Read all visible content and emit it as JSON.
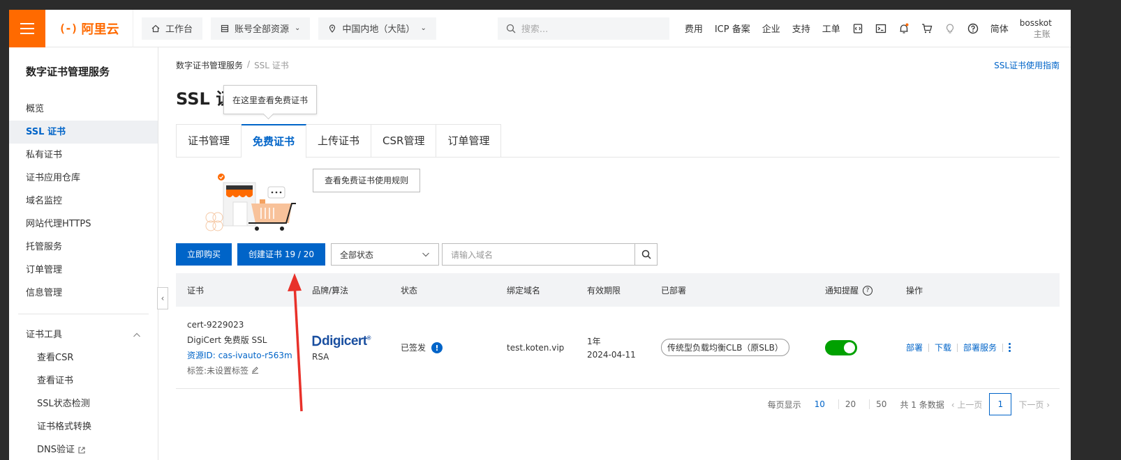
{
  "topbar": {
    "logo_text": "阿里云",
    "workbench": "工作台",
    "resources": "账号全部资源",
    "region": "中国内地（大陆）",
    "search_placeholder": "搜索...",
    "links": [
      "费用",
      "ICP 备案",
      "企业",
      "支持",
      "工单"
    ],
    "lang": "简体",
    "user": "bosskot",
    "user_sub": "主账"
  },
  "sidebar": {
    "title": "数字证书管理服务",
    "items": [
      {
        "label": "概览"
      },
      {
        "label": "SSL 证书",
        "active": true
      },
      {
        "label": "私有证书"
      },
      {
        "label": "证书应用仓库"
      },
      {
        "label": "域名监控"
      },
      {
        "label": "网站代理HTTPS"
      },
      {
        "label": "托管服务"
      },
      {
        "label": "订单管理"
      },
      {
        "label": "信息管理"
      }
    ],
    "group_title": "证书工具",
    "group_items": [
      {
        "label": "查看CSR"
      },
      {
        "label": "查看证书"
      },
      {
        "label": "SSL状态检测"
      },
      {
        "label": "证书格式转换"
      },
      {
        "label": "DNS验证"
      }
    ]
  },
  "main": {
    "breadcrumb": [
      "数字证书管理服务",
      "SSL 证书"
    ],
    "guide_link": "SSL证书使用指南",
    "title": "SSL 证",
    "tooltip": "在这里查看免费证书",
    "tabs": [
      "证书管理",
      "免费证书",
      "上传证书",
      "CSR管理",
      "订单管理"
    ],
    "active_tab": 1,
    "rules_button": "查看免费证书使用规则",
    "buy_button": "立即购买",
    "create_button": "创建证书 19 / 20",
    "status_select": "全部状态",
    "domain_placeholder": "请输入域名"
  },
  "table": {
    "headers": [
      "证书",
      "品牌/算法",
      "状态",
      "绑定域名",
      "有效期限",
      "已部署",
      "通知提醒",
      "操作"
    ],
    "row": {
      "cert_name": "cert-9229023",
      "cert_product": "DigiCert 免费版 SSL",
      "resource_id": "资源ID: cas-ivauto-r563m8",
      "tags": "标签:未设置标签",
      "brand": "digicert",
      "algo": "RSA",
      "status": "已签发",
      "domain": "test.koten.vip",
      "validity": "1年",
      "expire": "2024-04-11",
      "deployed": "传统型负载均衡CLB（原SLB）",
      "notify_on": true,
      "ops": [
        "部署",
        "下载",
        "部署服务"
      ]
    }
  },
  "pager": {
    "per_page_label": "每页显示",
    "sizes": [
      "10",
      "20",
      "50"
    ],
    "active_size": "10",
    "total": "共 1 条数据",
    "prev": "上一页",
    "page": "1",
    "next": "下一页"
  },
  "colors": {
    "brand_orange": "#ff6a00",
    "primary_blue": "#0064c8",
    "toggle_green": "#00a100",
    "arrow_red": "#e8312a"
  }
}
